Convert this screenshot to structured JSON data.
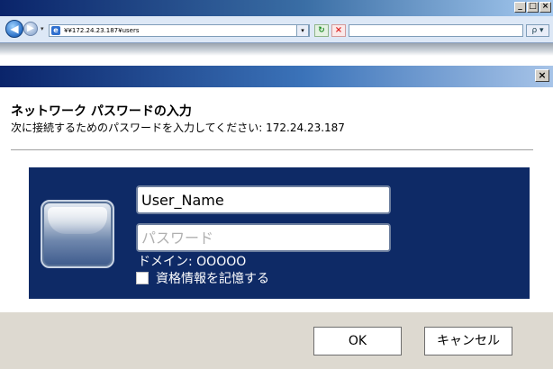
{
  "browser": {
    "address": "¥¥172.24.23.187¥users",
    "window_buttons": [
      "_",
      "□",
      "×"
    ],
    "nav_drop": "▾",
    "refresh_glyph": "⁴⁺",
    "stop_glyph": "×",
    "search_glyph": "ρ ▾",
    "addr_drop": "▾"
  },
  "dialog": {
    "close_glyph": "×",
    "title": "ネットワーク パスワードの入力",
    "subtitle": "次に接続するためのパスワードを入力してください: 172.24.23.187",
    "username_value": "User_Name",
    "password_placeholder": "パスワード",
    "domain_label": "ドメイン: OOOOO",
    "remember_label": "資格情報を記憶する",
    "remember_checked": false,
    "ok_label": "OK",
    "cancel_label": "キャンセル"
  }
}
